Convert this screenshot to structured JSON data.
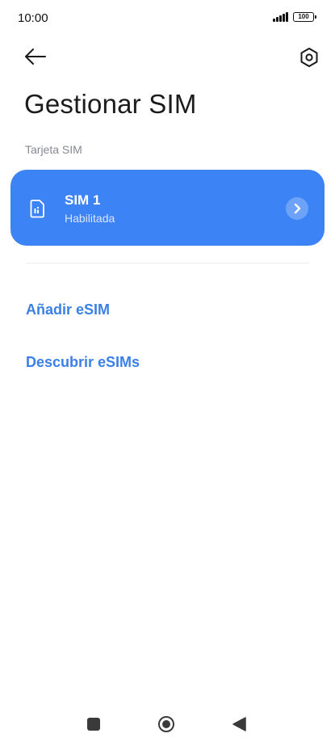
{
  "status_bar": {
    "time": "10:00",
    "battery_level": "100"
  },
  "header": {
    "back_icon": "arrow-left-icon",
    "settings_icon": "hexagon-gear-icon",
    "title": "Gestionar SIM"
  },
  "section": {
    "label": "Tarjeta SIM"
  },
  "sim_card": {
    "name": "SIM 1",
    "status": "Habilitada",
    "icon": "sim-card-icon",
    "accent_color": "#3c83f6"
  },
  "actions": {
    "add_esim": "Añadir eSIM",
    "discover_esims": "Descubrir eSIMs",
    "link_color": "#3a80e7"
  },
  "nav_bar": {
    "recents_icon": "square-icon",
    "home_icon": "circle-icon",
    "back_icon": "triangle-back-icon"
  }
}
